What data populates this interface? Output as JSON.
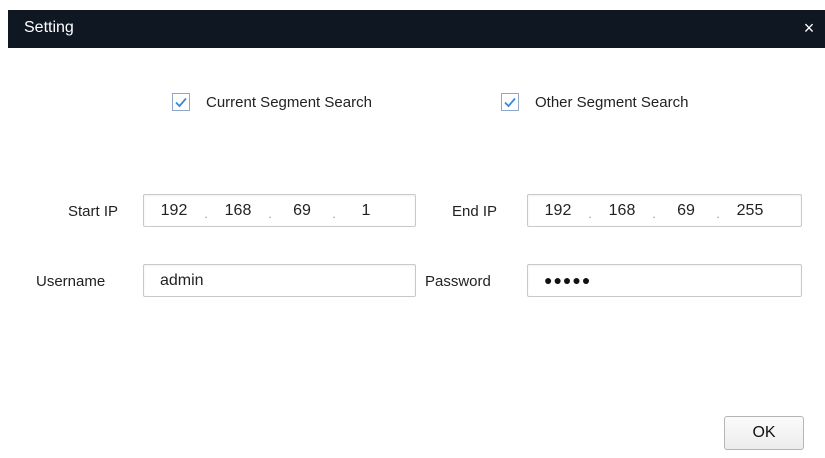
{
  "dialog": {
    "title": "Setting",
    "close_glyph": "×"
  },
  "search_options": {
    "current_segment": {
      "label": "Current Segment Search",
      "checked": true
    },
    "other_segment": {
      "label": "Other Segment Search",
      "checked": true
    }
  },
  "fields": {
    "start_ip": {
      "label": "Start IP",
      "octets": [
        "192",
        "168",
        "69",
        "1"
      ]
    },
    "end_ip": {
      "label": "End IP",
      "octets": [
        "192",
        "168",
        "69",
        "255"
      ]
    },
    "username": {
      "label": "Username",
      "value": "admin"
    },
    "password": {
      "label": "Password",
      "masked": "●●●●●"
    }
  },
  "buttons": {
    "ok_label": "OK"
  },
  "colors": {
    "titlebar": "#0f1723",
    "checkbox_border": "#8fa8c8",
    "checkmark": "#3b8ad8"
  },
  "icons": {
    "close": "close-icon",
    "checkbox": "checkmark-icon"
  }
}
